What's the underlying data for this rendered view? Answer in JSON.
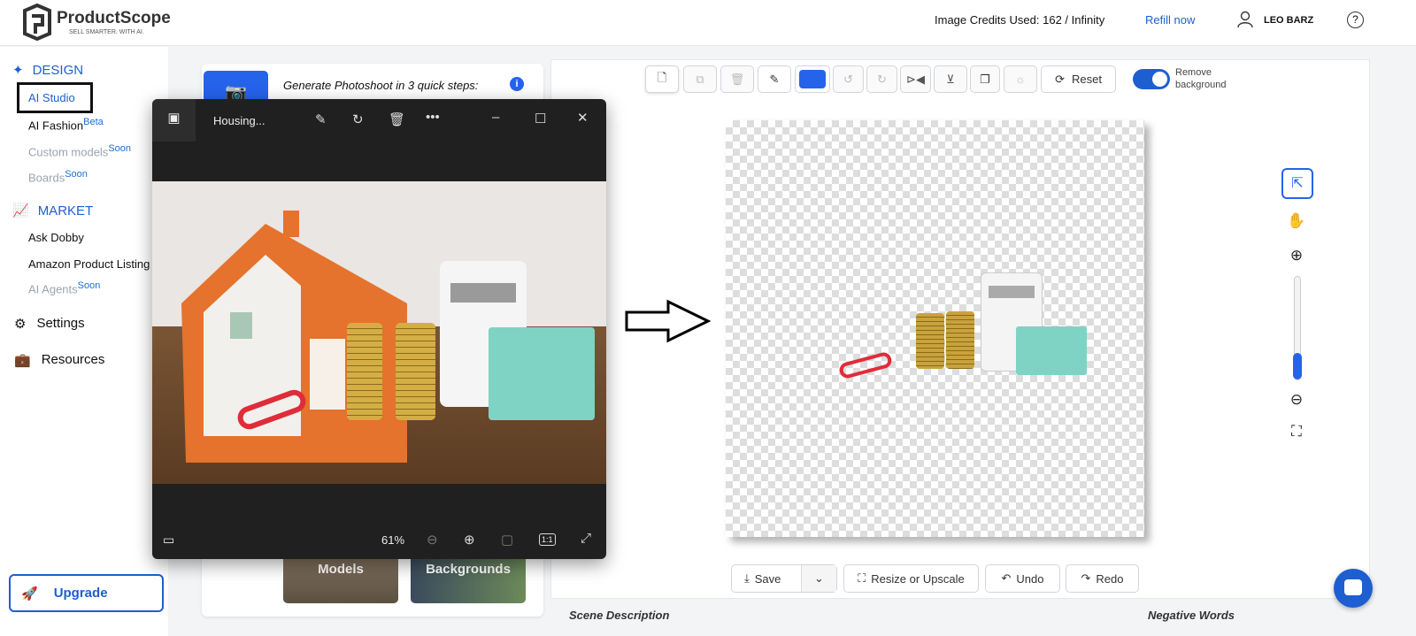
{
  "brand": {
    "name": "ProductScope",
    "tagline": "SELL SMARTER. WITH AI."
  },
  "header": {
    "credits": "Image Credits Used: 162 / Infinity",
    "refill": "Refill now",
    "user": "LEO BARZ",
    "help_icon": "question-circle-icon"
  },
  "sidebar": {
    "design": {
      "label": "DESIGN",
      "items": [
        {
          "label": "AI Studio"
        },
        {
          "label": "AI Fashion",
          "badge": "Beta"
        },
        {
          "label": "Custom models",
          "badge": "Soon"
        },
        {
          "label": "Boards",
          "badge": "Soon"
        }
      ]
    },
    "market": {
      "label": "MARKET",
      "items": [
        {
          "label": "Ask Dobby"
        },
        {
          "label": "Amazon Product Listing"
        },
        {
          "label": "AI Agents",
          "badge": "Soon"
        }
      ]
    },
    "settings": "Settings",
    "resources": "Resources",
    "upgrade": "Upgrade"
  },
  "left_card": {
    "title": "Generate Photoshoot in 3 quick steps:",
    "tiles": [
      "Models",
      "Backgrounds"
    ]
  },
  "viewer": {
    "title": "Housing...",
    "zoom": "61%",
    "one_to_one": "1:1"
  },
  "toolbar": {
    "reset": "Reset",
    "remove_bg": "Remove background",
    "remove_bg_on": true,
    "color": "#2563eb"
  },
  "bottom": {
    "save": "Save",
    "resize": "Resize or Upscale",
    "undo": "Undo",
    "redo": "Redo"
  },
  "labels": {
    "scene": "Scene Description",
    "negative": "Negative Words"
  },
  "colors": {
    "accent": "#1d5fd1",
    "viewer_bg": "#202020"
  }
}
